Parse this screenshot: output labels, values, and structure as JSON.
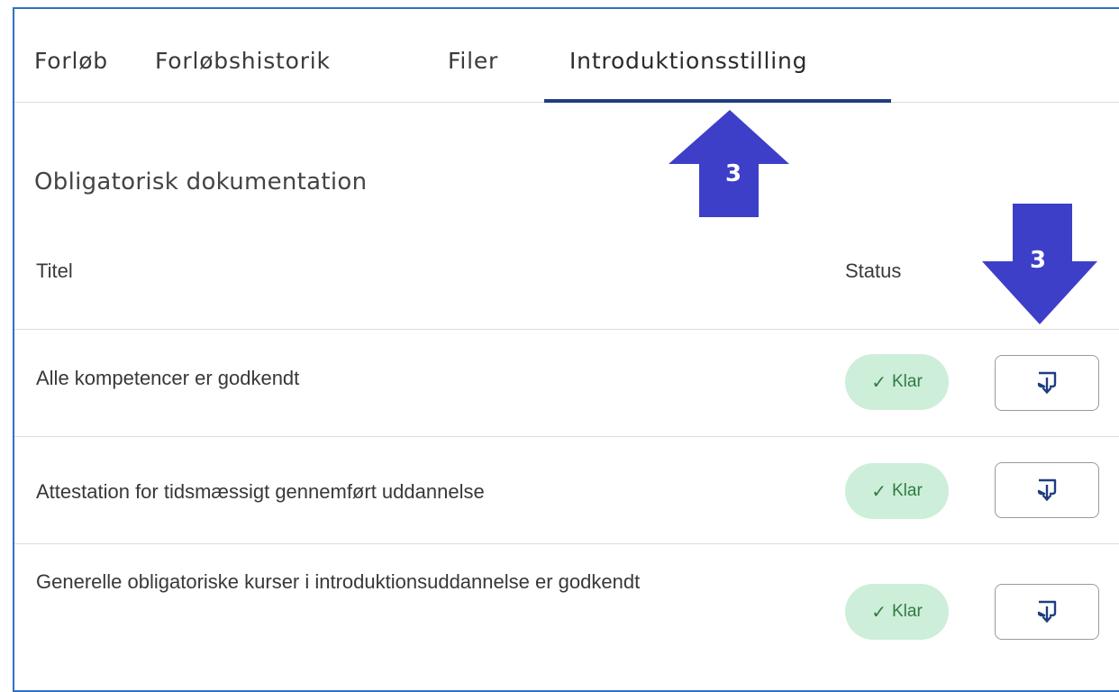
{
  "tabs": [
    {
      "label": "Forløb",
      "active": false
    },
    {
      "label": "Forløbshistorik",
      "active": false
    },
    {
      "label": "Filer",
      "active": false
    },
    {
      "label": "Introduktionsstilling",
      "active": true
    }
  ],
  "section": {
    "title": "Obligatorisk dokumentation"
  },
  "table": {
    "columns": {
      "title": "Titel",
      "status": "Status"
    },
    "rows": [
      {
        "title": "Alle kompetencer er godkendt",
        "status": "Klar",
        "action_icon": "download-icon"
      },
      {
        "title": "Attestation for tidsmæssigt gennemført uddannelse",
        "status": "Klar",
        "action_icon": "download-icon"
      },
      {
        "title": "Generelle obligatoriske kurser i introduktionsuddannelse er godkendt",
        "status": "Klar",
        "action_icon": "download-icon"
      }
    ]
  },
  "annotations": [
    {
      "label": "3",
      "direction": "up",
      "color": "#3d3fc8"
    },
    {
      "label": "3",
      "direction": "down",
      "color": "#3d3fc8"
    }
  ],
  "colors": {
    "frame": "#2e72c4",
    "tab_underline": "#1e3d80",
    "badge_bg": "#cdeed8",
    "badge_text": "#2f7b45",
    "icon": "#1e3d80"
  }
}
